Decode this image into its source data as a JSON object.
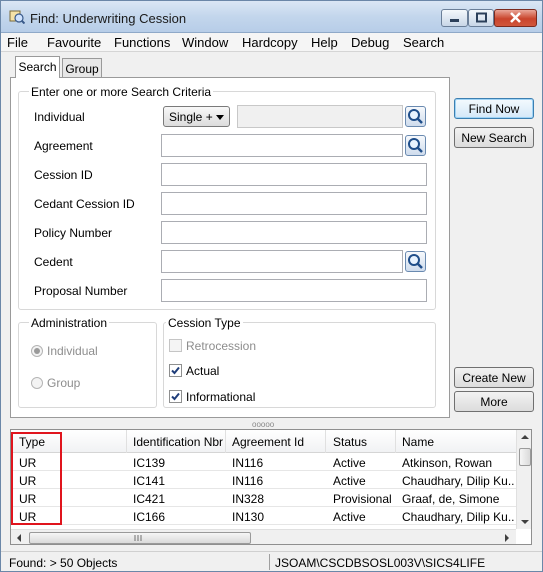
{
  "window": {
    "title": "Find: Underwriting Cession"
  },
  "menu": [
    "File",
    "Favourite",
    "Functions",
    "Window",
    "Hardcopy",
    "Help",
    "Debug",
    "Search"
  ],
  "tabs": [
    "Search",
    "Group"
  ],
  "criteria": {
    "group_title": "Enter one or more Search Criteria",
    "individual_label": "Individual",
    "individual_select": "Single +",
    "agreement_label": "Agreement",
    "cession_id_label": "Cession ID",
    "cedant_cession_id_label": "Cedant Cession ID",
    "policy_number_label": "Policy Number",
    "cedent_label": "Cedent",
    "proposal_number_label": "Proposal Number"
  },
  "administration": {
    "title": "Administration",
    "options": [
      "Individual",
      "Group"
    ]
  },
  "cession_type": {
    "title": "Cession Type",
    "options": [
      {
        "label": "Retrocession",
        "checked": false,
        "enabled": false
      },
      {
        "label": "Actual",
        "checked": true,
        "enabled": true
      },
      {
        "label": "Informational",
        "checked": true,
        "enabled": true
      }
    ]
  },
  "buttons": {
    "find_now": "Find Now",
    "new_search": "New Search",
    "create_new": "Create New",
    "more": "More"
  },
  "splitter": "ooooo",
  "table": {
    "columns": [
      "Type",
      "Identification Nbr",
      "Agreement Id",
      "Status",
      "Name"
    ],
    "rows": [
      [
        "UR",
        "IC139",
        "IN116",
        "Active",
        "Atkinson, Rowan"
      ],
      [
        "UR",
        "IC141",
        "IN116",
        "Active",
        "Chaudhary, Dilip Ku..."
      ],
      [
        "UR",
        "IC421",
        "IN328",
        "Provisional",
        "Graaf, de, Simone"
      ],
      [
        "UR",
        "IC166",
        "IN130",
        "Active",
        "Chaudhary, Dilip Ku..."
      ]
    ]
  },
  "status": {
    "found": "Found: > 50 Objects",
    "connection": "JSOAM\\CSCDBSOSL003V\\SICS4LIFE"
  },
  "colors": {
    "highlight": "#e0141d",
    "titlebar": "#c3d6ec"
  }
}
